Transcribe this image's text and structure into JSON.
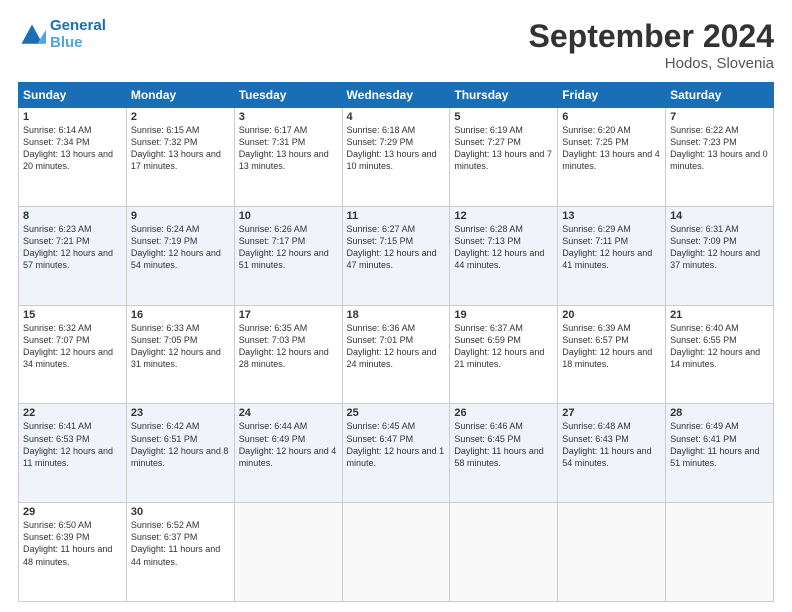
{
  "header": {
    "logo_line1": "General",
    "logo_line2": "Blue",
    "month_title": "September 2024",
    "location": "Hodos, Slovenia"
  },
  "weekdays": [
    "Sunday",
    "Monday",
    "Tuesday",
    "Wednesday",
    "Thursday",
    "Friday",
    "Saturday"
  ],
  "weeks": [
    [
      {
        "day": "1",
        "sunrise": "6:14 AM",
        "sunset": "7:34 PM",
        "daylight": "13 hours and 20 minutes."
      },
      {
        "day": "2",
        "sunrise": "6:15 AM",
        "sunset": "7:32 PM",
        "daylight": "13 hours and 17 minutes."
      },
      {
        "day": "3",
        "sunrise": "6:17 AM",
        "sunset": "7:31 PM",
        "daylight": "13 hours and 13 minutes."
      },
      {
        "day": "4",
        "sunrise": "6:18 AM",
        "sunset": "7:29 PM",
        "daylight": "13 hours and 10 minutes."
      },
      {
        "day": "5",
        "sunrise": "6:19 AM",
        "sunset": "7:27 PM",
        "daylight": "13 hours and 7 minutes."
      },
      {
        "day": "6",
        "sunrise": "6:20 AM",
        "sunset": "7:25 PM",
        "daylight": "13 hours and 4 minutes."
      },
      {
        "day": "7",
        "sunrise": "6:22 AM",
        "sunset": "7:23 PM",
        "daylight": "13 hours and 0 minutes."
      }
    ],
    [
      {
        "day": "8",
        "sunrise": "6:23 AM",
        "sunset": "7:21 PM",
        "daylight": "12 hours and 57 minutes."
      },
      {
        "day": "9",
        "sunrise": "6:24 AM",
        "sunset": "7:19 PM",
        "daylight": "12 hours and 54 minutes."
      },
      {
        "day": "10",
        "sunrise": "6:26 AM",
        "sunset": "7:17 PM",
        "daylight": "12 hours and 51 minutes."
      },
      {
        "day": "11",
        "sunrise": "6:27 AM",
        "sunset": "7:15 PM",
        "daylight": "12 hours and 47 minutes."
      },
      {
        "day": "12",
        "sunrise": "6:28 AM",
        "sunset": "7:13 PM",
        "daylight": "12 hours and 44 minutes."
      },
      {
        "day": "13",
        "sunrise": "6:29 AM",
        "sunset": "7:11 PM",
        "daylight": "12 hours and 41 minutes."
      },
      {
        "day": "14",
        "sunrise": "6:31 AM",
        "sunset": "7:09 PM",
        "daylight": "12 hours and 37 minutes."
      }
    ],
    [
      {
        "day": "15",
        "sunrise": "6:32 AM",
        "sunset": "7:07 PM",
        "daylight": "12 hours and 34 minutes."
      },
      {
        "day": "16",
        "sunrise": "6:33 AM",
        "sunset": "7:05 PM",
        "daylight": "12 hours and 31 minutes."
      },
      {
        "day": "17",
        "sunrise": "6:35 AM",
        "sunset": "7:03 PM",
        "daylight": "12 hours and 28 minutes."
      },
      {
        "day": "18",
        "sunrise": "6:36 AM",
        "sunset": "7:01 PM",
        "daylight": "12 hours and 24 minutes."
      },
      {
        "day": "19",
        "sunrise": "6:37 AM",
        "sunset": "6:59 PM",
        "daylight": "12 hours and 21 minutes."
      },
      {
        "day": "20",
        "sunrise": "6:39 AM",
        "sunset": "6:57 PM",
        "daylight": "12 hours and 18 minutes."
      },
      {
        "day": "21",
        "sunrise": "6:40 AM",
        "sunset": "6:55 PM",
        "daylight": "12 hours and 14 minutes."
      }
    ],
    [
      {
        "day": "22",
        "sunrise": "6:41 AM",
        "sunset": "6:53 PM",
        "daylight": "12 hours and 11 minutes."
      },
      {
        "day": "23",
        "sunrise": "6:42 AM",
        "sunset": "6:51 PM",
        "daylight": "12 hours and 8 minutes."
      },
      {
        "day": "24",
        "sunrise": "6:44 AM",
        "sunset": "6:49 PM",
        "daylight": "12 hours and 4 minutes."
      },
      {
        "day": "25",
        "sunrise": "6:45 AM",
        "sunset": "6:47 PM",
        "daylight": "12 hours and 1 minute."
      },
      {
        "day": "26",
        "sunrise": "6:46 AM",
        "sunset": "6:45 PM",
        "daylight": "11 hours and 58 minutes."
      },
      {
        "day": "27",
        "sunrise": "6:48 AM",
        "sunset": "6:43 PM",
        "daylight": "11 hours and 54 minutes."
      },
      {
        "day": "28",
        "sunrise": "6:49 AM",
        "sunset": "6:41 PM",
        "daylight": "11 hours and 51 minutes."
      }
    ],
    [
      {
        "day": "29",
        "sunrise": "6:50 AM",
        "sunset": "6:39 PM",
        "daylight": "11 hours and 48 minutes."
      },
      {
        "day": "30",
        "sunrise": "6:52 AM",
        "sunset": "6:37 PM",
        "daylight": "11 hours and 44 minutes."
      },
      null,
      null,
      null,
      null,
      null
    ]
  ],
  "labels": {
    "sunrise": "Sunrise:",
    "sunset": "Sunset:",
    "daylight": "Daylight:"
  }
}
